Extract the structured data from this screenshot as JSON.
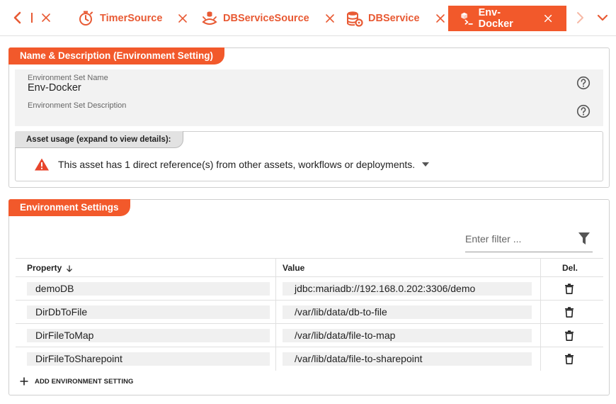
{
  "tabs": [
    {
      "label": "TimerSource",
      "icon": "timer-icon"
    },
    {
      "label": "DBServiceSource",
      "icon": "db-service-source-icon"
    },
    {
      "label": "DBService",
      "icon": "db-service-icon"
    },
    {
      "label": "Env-Docker",
      "icon": "env-docker-icon",
      "active": true
    }
  ],
  "name_section": {
    "title": "Name & Description (Environment Setting)",
    "name_label": "Environment Set Name",
    "name_value": "Env-Docker",
    "description_label": "Environment Set Description",
    "description_value": ""
  },
  "asset_usage": {
    "header": "Asset usage (expand to view details):",
    "message": "This asset has 1 direct reference(s) from other assets, workflows or deployments."
  },
  "settings_section": {
    "title": "Environment Settings",
    "filter_placeholder": "Enter filter ...",
    "columns": {
      "property": "Property",
      "value": "Value",
      "delete": "Del."
    },
    "rows": [
      {
        "property": "demoDB",
        "value": "jdbc:mariadb://192.168.0.202:3306/demo"
      },
      {
        "property": "DirDbToFile",
        "value": "/var/lib/data/db-to-file"
      },
      {
        "property": "DirFileToMap",
        "value": "/var/lib/data/file-to-map"
      },
      {
        "property": "DirFileToSharepoint",
        "value": "/var/lib/data/file-to-sharepoint"
      }
    ],
    "add_label": "ADD ENVIRONMENT SETTING"
  },
  "colors": {
    "accent": "#f2592b",
    "accent_text": "#e85a34",
    "warning": "#e8452c"
  }
}
